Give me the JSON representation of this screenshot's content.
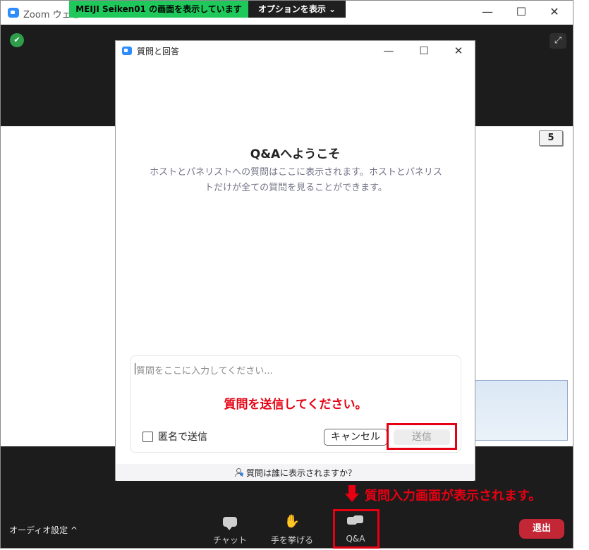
{
  "window": {
    "app_title": "Zoom ウェビ",
    "share_banner": "MEIJI Seiken01 の画面を表示しています",
    "options_label": "オプションを表示 ⌄",
    "minimize_glyph": "—",
    "maximize_glyph": "☐",
    "close_glyph": "✕"
  },
  "shared_screen": {
    "page_number": "5"
  },
  "qa_dialog": {
    "title": "質問と回答",
    "welcome_title": "Q&Aへようこそ",
    "welcome_description": "ホストとパネリストへの質問はここに表示されます。ホストとパネリストだけが全ての質問を見ることができます。",
    "input_placeholder": "質問をここに入力してください...",
    "anonymous_label": "匿名で送信",
    "cancel_label": "キャンセル",
    "send_label": "送信",
    "who_can_see": "質問は誰に表示されますか？"
  },
  "annotations": {
    "send_instruction": "質問を送信してください。",
    "qa_callout": "質問入力画面が表示されます。"
  },
  "toolbar": {
    "audio_settings": "オーディオ設定  ^",
    "chat_label": "チャット",
    "raise_hand_label": "手を挙げる",
    "qa_label": "Q&A",
    "leave_label": "退出"
  },
  "colors": {
    "annotation_red": "#e60012",
    "banner_green": "#1ec85a",
    "zoom_blue": "#2d8cff",
    "leave_red": "#c32635"
  }
}
